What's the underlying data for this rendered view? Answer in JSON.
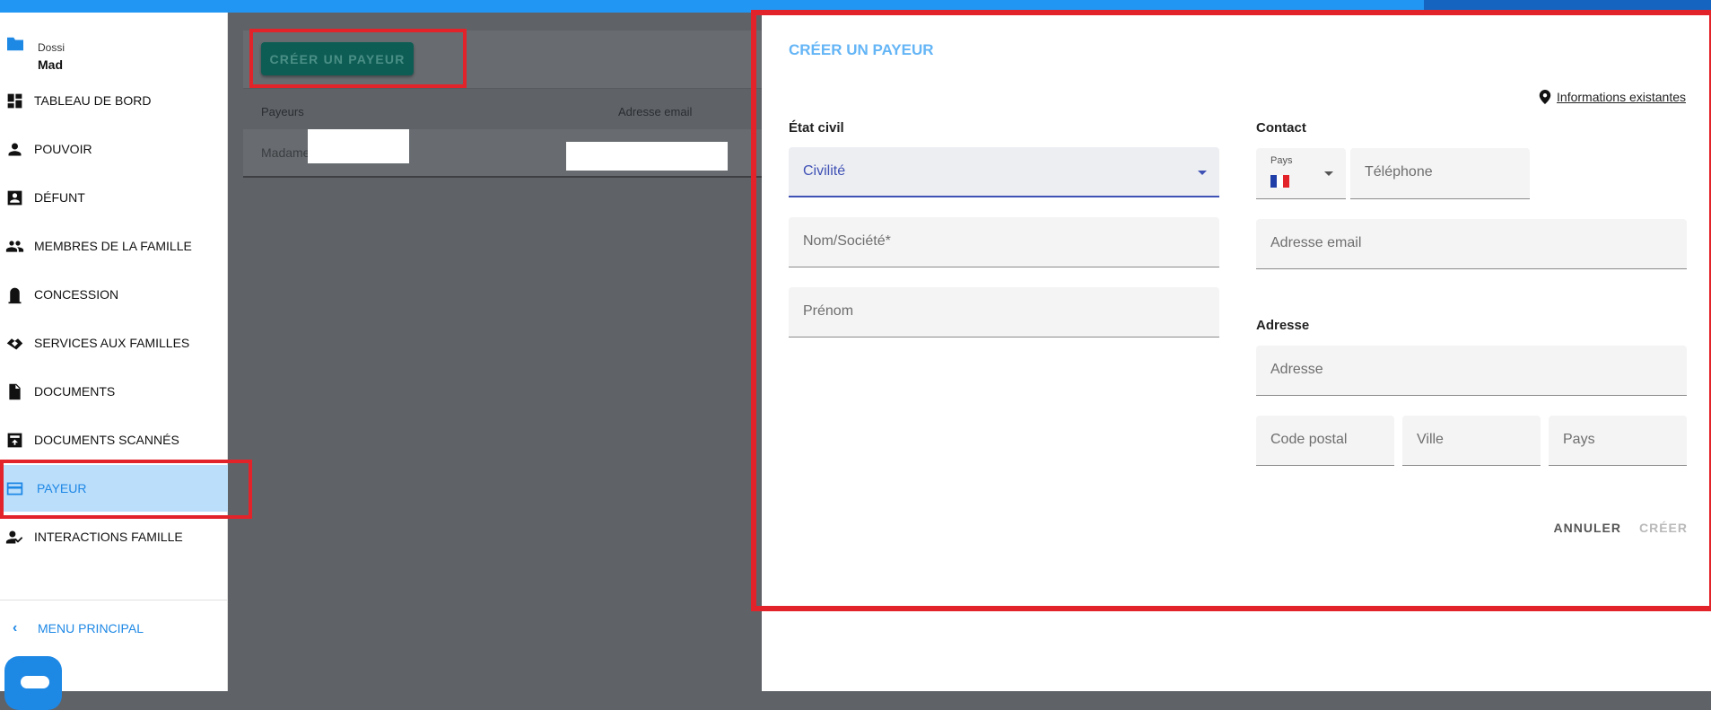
{
  "sidebar": {
    "dossier_line1": "Dossi",
    "dossier_line2": "Mad",
    "items": [
      {
        "label": "TABLEAU DE BORD",
        "icon": "dashboard-icon"
      },
      {
        "label": "POUVOIR",
        "icon": "person-icon"
      },
      {
        "label": "DÉFUNT",
        "icon": "contact-card-icon"
      },
      {
        "label": "MEMBRES DE LA FAMILLE",
        "icon": "people-icon"
      },
      {
        "label": "CONCESSION",
        "icon": "tombstone-icon"
      },
      {
        "label": "SERVICES AUX FAMILLES",
        "icon": "handshake-icon"
      },
      {
        "label": "DOCUMENTS",
        "icon": "document-icon"
      },
      {
        "label": "DOCUMENTS SCANNÉS",
        "icon": "scanned-document-icon"
      },
      {
        "label": "PAYEUR",
        "icon": "credit-card-icon",
        "active": true
      },
      {
        "label": "INTERACTIONS FAMILLE",
        "icon": "person-interaction-icon"
      }
    ],
    "menu_principal": "MENU PRINCIPAL"
  },
  "main": {
    "create_button": "CRÉER UN PAYEUR",
    "table_headers": [
      "Payeurs",
      "Adresse email"
    ],
    "row_payeur": "Madame"
  },
  "dialog": {
    "title": "CRÉER UN PAYEUR",
    "info_link": "Informations existantes",
    "etat_civil_title": "État civil",
    "civilite": "Civilité",
    "nom": "Nom/Société*",
    "prenom": "Prénom",
    "contact_title": "Contact",
    "pays_label": "Pays",
    "telephone": "Téléphone",
    "email": "Adresse email",
    "adresse_title": "Adresse",
    "adresse": "Adresse",
    "code_postal": "Code postal",
    "ville": "Ville",
    "pays": "Pays",
    "annuler": "ANNULER",
    "creer": "CRÉER"
  },
  "colors": {
    "accent": "#1e88e5",
    "highlight": "#e3232a",
    "primary_button": "#0e5d55",
    "title": "#64b5f6",
    "focus": "#3f51b5"
  }
}
